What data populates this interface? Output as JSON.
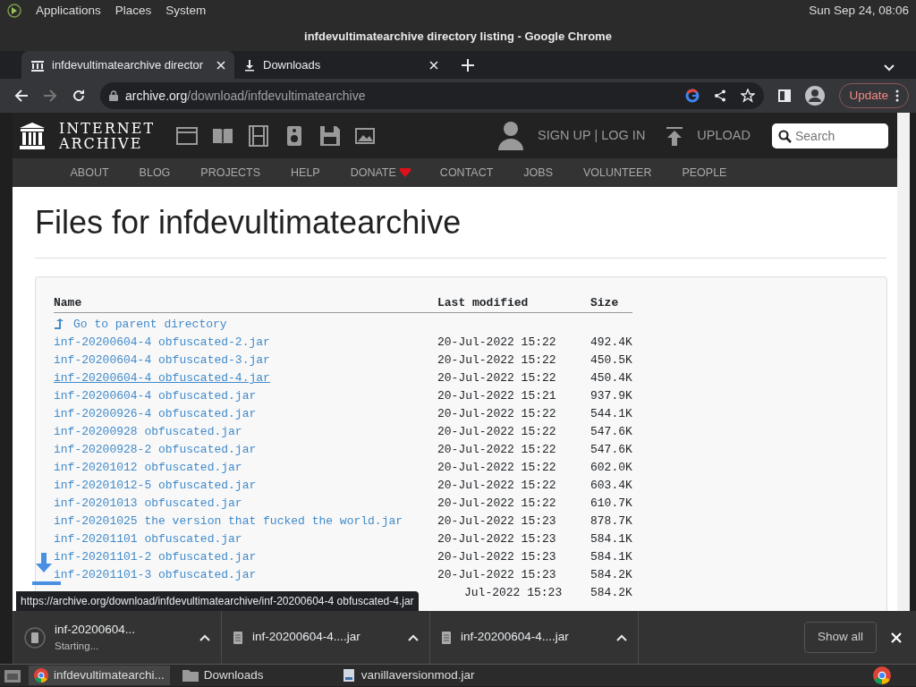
{
  "top_panel": {
    "menus": [
      "Applications",
      "Places",
      "System"
    ],
    "clock": "Sun Sep 24, 08:06"
  },
  "window": {
    "title": "infdevultimatearchive directory listing - Google Chrome"
  },
  "tabs": [
    {
      "label": "infdevultimatearchive director",
      "selected": true,
      "kind": "site"
    },
    {
      "label": "Downloads",
      "selected": false,
      "kind": "download"
    }
  ],
  "address_bar": {
    "host": "archive.org",
    "path": "/download/infdevultimatearchive"
  },
  "update_button": "Update",
  "site_header": {
    "logo_line1": "INTERNET",
    "logo_line2": "ARCHIVE",
    "account": "SIGN UP | LOG IN",
    "upload": "UPLOAD",
    "search": {
      "placeholder": "Search"
    },
    "nav": [
      {
        "label": "ABOUT",
        "kind": "text"
      },
      {
        "label": "BLOG",
        "kind": "text"
      },
      {
        "label": "PROJECTS",
        "kind": "text"
      },
      {
        "label": "HELP",
        "kind": "text"
      },
      {
        "label": "DONATE",
        "kind": "heart"
      },
      {
        "label": "CONTACT",
        "kind": "text"
      },
      {
        "label": "JOBS",
        "kind": "text"
      },
      {
        "label": "VOLUNTEER",
        "kind": "text"
      },
      {
        "label": "PEOPLE",
        "kind": "text"
      }
    ]
  },
  "heading": "Files for infdevultimatearchive",
  "table": {
    "columns": [
      "Name",
      "Last modified",
      "Size"
    ],
    "parent_link": "Go to parent directory",
    "rows": [
      {
        "name": "inf-20200604-4 obfuscated-2.jar",
        "modified": "20-Jul-2022 15:22",
        "size": "492.4K",
        "hovered": false
      },
      {
        "name": "inf-20200604-4 obfuscated-3.jar",
        "modified": "20-Jul-2022 15:22",
        "size": "450.5K",
        "hovered": false
      },
      {
        "name": "inf-20200604-4 obfuscated-4.jar",
        "modified": "20-Jul-2022 15:22",
        "size": "450.4K",
        "hovered": true
      },
      {
        "name": "inf-20200604-4 obfuscated.jar",
        "modified": "20-Jul-2022 15:21",
        "size": "937.9K",
        "hovered": false
      },
      {
        "name": "inf-20200926-4 obfuscated.jar",
        "modified": "20-Jul-2022 15:22",
        "size": "544.1K",
        "hovered": false
      },
      {
        "name": "inf-20200928 obfuscated.jar",
        "modified": "20-Jul-2022 15:22",
        "size": "547.6K",
        "hovered": false
      },
      {
        "name": "inf-20200928-2 obfuscated.jar",
        "modified": "20-Jul-2022 15:22",
        "size": "547.6K",
        "hovered": false
      },
      {
        "name": "inf-20201012 obfuscated.jar",
        "modified": "20-Jul-2022 15:22",
        "size": "602.0K",
        "hovered": false
      },
      {
        "name": "inf-20201012-5 obfuscated.jar",
        "modified": "20-Jul-2022 15:22",
        "size": "603.4K",
        "hovered": false
      },
      {
        "name": "inf-20201013 obfuscated.jar",
        "modified": "20-Jul-2022 15:22",
        "size": "610.7K",
        "hovered": false
      },
      {
        "name": "inf-20201025 the version that fucked the world.jar",
        "modified": "20-Jul-2022 15:23",
        "size": "878.7K",
        "hovered": false
      },
      {
        "name": "inf-20201101 obfuscated.jar",
        "modified": "20-Jul-2022 15:23",
        "size": "584.1K",
        "hovered": false
      },
      {
        "name": "inf-20201101-2 obfuscated.jar",
        "modified": "20-Jul-2022 15:23",
        "size": "584.1K",
        "hovered": false
      },
      {
        "name": "inf-20201101-3 obfuscated.jar",
        "modified": "20-Jul-2022 15:23",
        "size": "584.2K",
        "hovered": false
      }
    ],
    "partial_row": {
      "modified": "Jul-2022 15:23",
      "size": "584.2K"
    }
  },
  "status_tooltip": "https://archive.org/download/infdevultimatearchive/inf-20200604-4 obfuscated-4.jar",
  "downloads": [
    {
      "name": "inf-20200604...",
      "status": "Starting..."
    },
    {
      "name": "inf-20200604-4....jar"
    },
    {
      "name": "inf-20200604-4....jar"
    }
  ],
  "show_all": "Show all",
  "taskbar": [
    {
      "label": "infdevultimatearchi...",
      "selected": true,
      "kind": "chrome"
    },
    {
      "label": "Downloads",
      "selected": false,
      "kind": "folder"
    },
    {
      "label": "vanillaversionmod.jar",
      "selected": false,
      "kind": "jar"
    }
  ]
}
